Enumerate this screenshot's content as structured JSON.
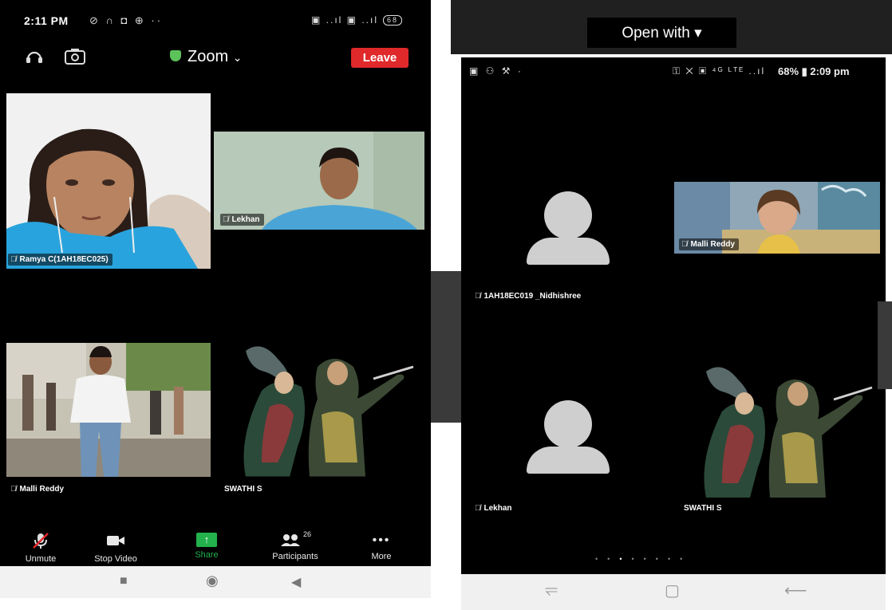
{
  "left_phone": {
    "status_time": "2:11 PM",
    "status_left_icons": "⊘ ∩ ◘ ⊕ ··",
    "status_right_icons": "▣ ..ıl ▣ ..ıl",
    "battery": "68",
    "app_title": "Zoom",
    "leave_label": "Leave",
    "participants": [
      {
        "name": "Ramya C(1AH18EC025)"
      },
      {
        "name": "Lekhan"
      },
      {
        "name": "Malli Reddy"
      },
      {
        "name": "SWATHI S"
      }
    ],
    "toolbar": {
      "unmute": "Unmute",
      "stop_video": "Stop Video",
      "share": "Share",
      "participants": "Participants",
      "participants_count": "26",
      "more": "More"
    }
  },
  "viewer": {
    "open_with_label": "Open with"
  },
  "right_phone": {
    "status_left_icons": "▣ ⚇ ⚒ ·",
    "status_right_icons": "⚿ ✕ ▣ ⁴ᴳ ᴸᵀᴱ ..ıl",
    "status_time": "68% ▮ 2:09 pm",
    "participants": [
      {
        "name": "1AH18EC019 _Nidhishree"
      },
      {
        "name": "Malli Reddy"
      },
      {
        "name": "Lekhan"
      },
      {
        "name": "SWATHI S"
      }
    ],
    "page_count": 8,
    "active_page": 3
  },
  "colors": {
    "leave": "#e0292a",
    "share": "#22b14c",
    "zoom_shield": "#5cc35a"
  }
}
